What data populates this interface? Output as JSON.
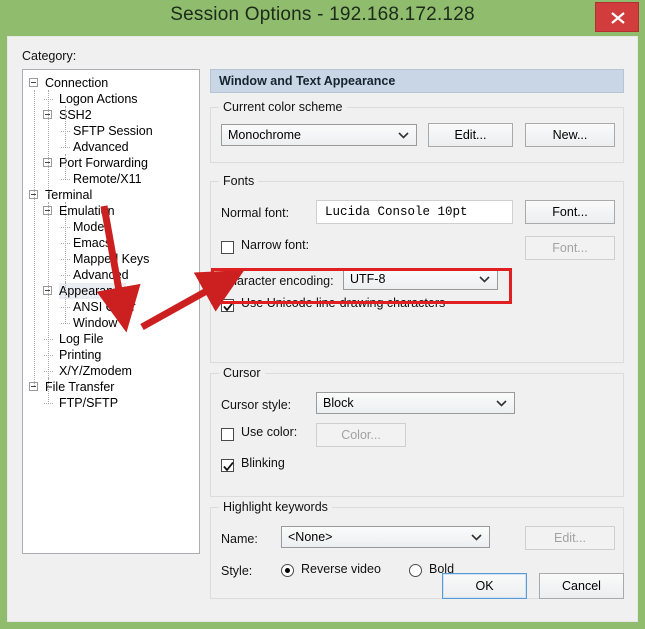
{
  "window": {
    "title": "Session Options - 192.168.172.128",
    "close_label": "✕",
    "close_icon": "close-icon"
  },
  "category": {
    "label": "Category:",
    "selected": "Appearance",
    "items": [
      {
        "label": "Connection",
        "depth": 0,
        "expander": true
      },
      {
        "label": "Logon Actions",
        "depth": 1,
        "expander": false
      },
      {
        "label": "SSH2",
        "depth": 1,
        "expander": true
      },
      {
        "label": "SFTP Session",
        "depth": 2,
        "expander": false
      },
      {
        "label": "Advanced",
        "depth": 2,
        "expander": false
      },
      {
        "label": "Port Forwarding",
        "depth": 1,
        "expander": true
      },
      {
        "label": "Remote/X11",
        "depth": 2,
        "expander": false
      },
      {
        "label": "Terminal",
        "depth": 0,
        "expander": true
      },
      {
        "label": "Emulation",
        "depth": 1,
        "expander": true
      },
      {
        "label": "Modes",
        "depth": 2,
        "expander": false
      },
      {
        "label": "Emacs",
        "depth": 2,
        "expander": false
      },
      {
        "label": "Mapped Keys",
        "depth": 2,
        "expander": false
      },
      {
        "label": "Advanced",
        "depth": 2,
        "expander": false
      },
      {
        "label": "Appearance",
        "depth": 1,
        "expander": true
      },
      {
        "label": "ANSI Color",
        "depth": 2,
        "expander": false
      },
      {
        "label": "Window",
        "depth": 2,
        "expander": false
      },
      {
        "label": "Log File",
        "depth": 1,
        "expander": false
      },
      {
        "label": "Printing",
        "depth": 1,
        "expander": false
      },
      {
        "label": "X/Y/Zmodem",
        "depth": 1,
        "expander": false
      },
      {
        "label": "File Transfer",
        "depth": 0,
        "expander": true
      },
      {
        "label": "FTP/SFTP",
        "depth": 1,
        "expander": false
      }
    ]
  },
  "pane": {
    "header": "Window and Text Appearance",
    "color_scheme": {
      "legend": "Current color scheme",
      "value": "Monochrome",
      "edit_label": "Edit...",
      "new_label": "New..."
    },
    "fonts": {
      "legend": "Fonts",
      "normal_font_label": "Normal font:",
      "normal_font_value": "Lucida Console 10pt",
      "font_button_label": "Font...",
      "narrow_font_label": "Narrow font:",
      "narrow_font_checked": false,
      "narrow_font_button_label": "Font...",
      "encoding_label": "Character encoding:",
      "encoding_value": "UTF-8",
      "unicode_label": "Use Unicode line-drawing characters",
      "unicode_checked": true
    },
    "cursor": {
      "legend": "Cursor",
      "style_label": "Cursor style:",
      "style_value": "Block",
      "use_color_label": "Use color:",
      "use_color_checked": false,
      "color_button_label": "Color...",
      "blinking_label": "Blinking",
      "blinking_checked": true
    },
    "highlight": {
      "legend": "Highlight keywords",
      "name_label": "Name:",
      "name_value": "<None>",
      "edit_label": "Edit...",
      "style_label": "Style:",
      "reverse_video_label": "Reverse video",
      "bold_label": "Bold",
      "selected_style": "Reverse video"
    }
  },
  "footer": {
    "ok_label": "OK",
    "cancel_label": "Cancel"
  },
  "annotations": {
    "highlight_color": "#e02020",
    "arrow_color": "#cc2020",
    "arrow_count": 2
  },
  "colors": {
    "titlebar": "#8fbc6d",
    "dialog": "#f0f0f0",
    "pane_header": "#c9d6e5",
    "close_button": "#d13c3c",
    "focus_border": "#5b9bd5"
  }
}
